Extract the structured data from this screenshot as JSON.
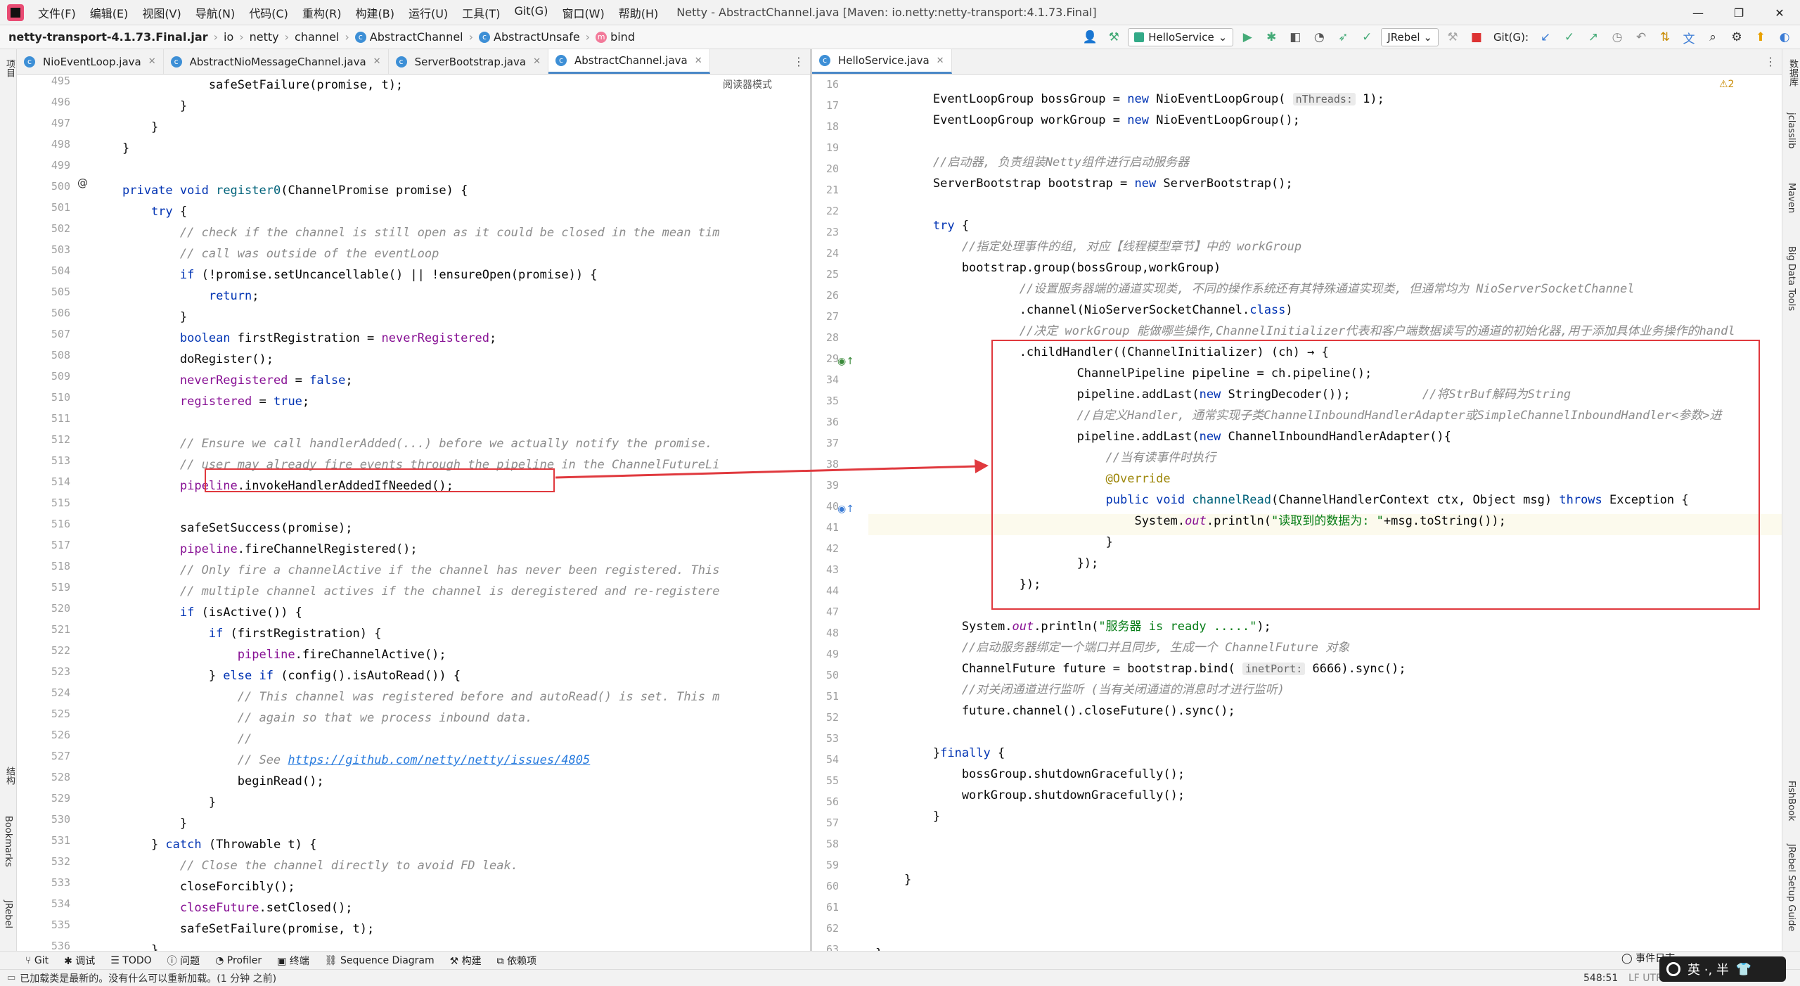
{
  "menu": [
    "文件(F)",
    "编辑(E)",
    "视图(V)",
    "导航(N)",
    "代码(C)",
    "重构(R)",
    "构建(B)",
    "运行(U)",
    "工具(T)",
    "Git(G)",
    "窗口(W)",
    "帮助(H)"
  ],
  "window_title": "Netty - AbstractChannel.java [Maven: io.netty:netty-transport:4.1.73.Final]",
  "window_controls": [
    "—",
    "❐",
    "✕"
  ],
  "breadcrumb": {
    "jar": "netty-transport-4.1.73.Final.jar",
    "p1": "io",
    "p2": "netty",
    "p3": "channel",
    "c1": "AbstractChannel",
    "c2": "AbstractUnsafe",
    "m": "bind"
  },
  "toolbar": {
    "run_config": "HelloService",
    "jrebel": "JRebel",
    "git_label": "Git(G):"
  },
  "left_tabs": [
    {
      "label": "NioEventLoop.java"
    },
    {
      "label": "AbstractNioMessageChannel.java"
    },
    {
      "label": "ServerBootstrap.java"
    },
    {
      "label": "AbstractChannel.java"
    }
  ],
  "right_tabs": [
    {
      "label": "HelloService.java"
    }
  ],
  "reader_mode": "阅读器模式",
  "warning_count": "⚠2",
  "left_gutter": [
    "495",
    "496",
    "497",
    "498",
    "499",
    "500",
    "501",
    "502",
    "503",
    "504",
    "505",
    "506",
    "507",
    "508",
    "509",
    "510",
    "511",
    "512",
    "513",
    "514",
    "515",
    "516",
    "517",
    "518",
    "519",
    "520",
    "521",
    "522",
    "523",
    "524",
    "525",
    "526",
    "527",
    "528",
    "529",
    "530",
    "531",
    "532",
    "533",
    "534",
    "535",
    "536"
  ],
  "right_gutter": [
    "16",
    "17",
    "18",
    "19",
    "20",
    "21",
    "22",
    "23",
    "24",
    "25",
    "26",
    "27",
    "28",
    "29",
    "34",
    "35",
    "36",
    "37",
    "38",
    "39",
    "40",
    "41",
    "42",
    "43",
    "44",
    "47",
    "48",
    "49",
    "50",
    "51",
    "52",
    "53",
    "54",
    "55",
    "56",
    "57",
    "58",
    "59",
    "60",
    "61",
    "62",
    "63"
  ],
  "left_strip_labels": [
    "项目",
    "结构",
    "Bookmarks",
    "JRebel"
  ],
  "right_strip_labels": [
    "数据库",
    "jclasslib",
    "Maven",
    "Big Data Tools",
    "FishBook",
    "JRebel Setup Guide"
  ],
  "bottom_tools": [
    "Git",
    "调试",
    "TODO",
    "问题",
    "Profiler",
    "终端",
    "Sequence Diagram",
    "构建",
    "依赖项"
  ],
  "events_label": "事件日志",
  "status": {
    "message": "已加载类是最新的。没有什么可以重新加载。(1 分钟 之前)",
    "position": "548:51",
    "encoding": "LF  UTF-8"
  },
  "ime": {
    "text": "英 ·, 半"
  },
  "colors": {
    "highlight_box": "#e0393e",
    "arrow": "#e0393e",
    "keyword": "#0033b3",
    "comment": "#8c8c8c",
    "string": "#067d17",
    "field": "#871094"
  }
}
